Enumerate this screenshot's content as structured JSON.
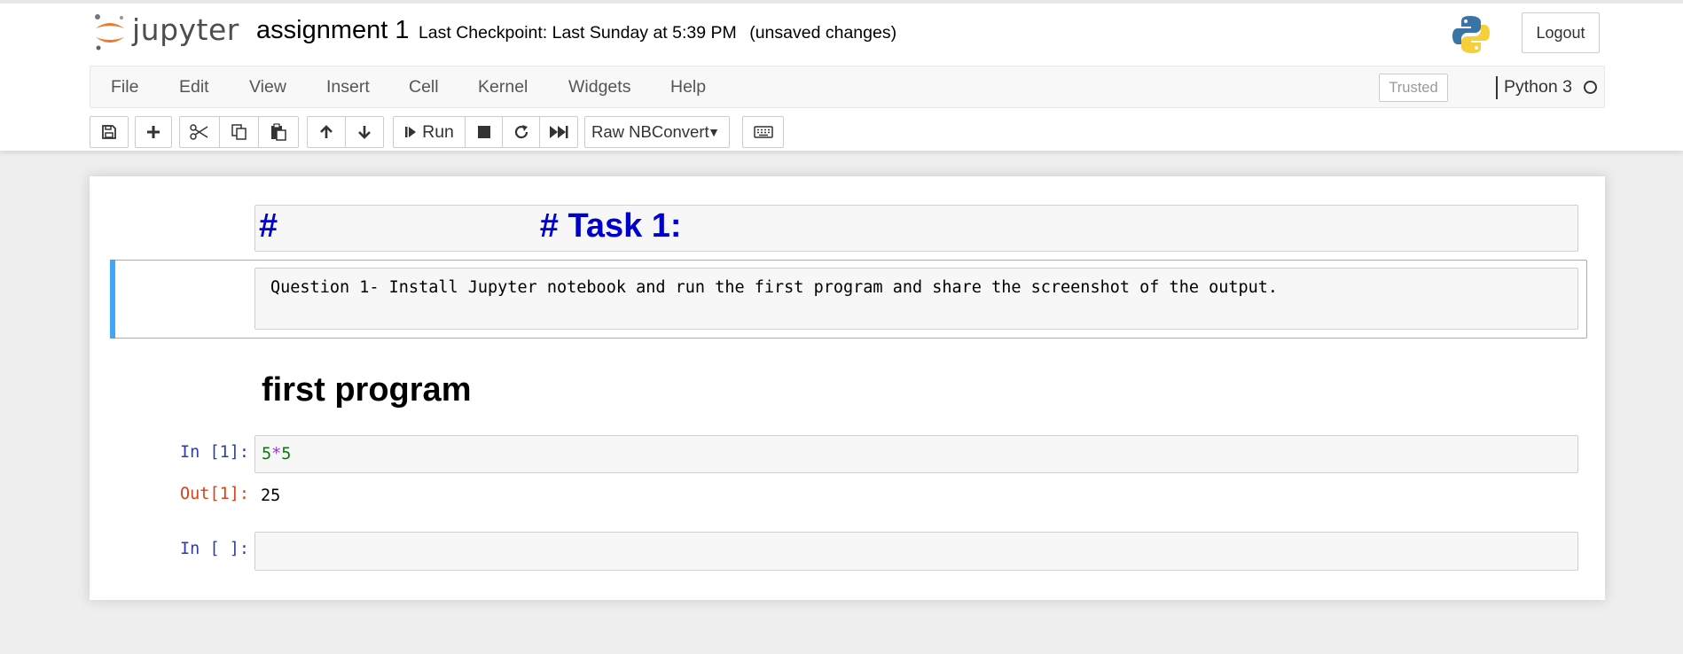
{
  "header": {
    "logo_text": "jupyter",
    "notebook_name": "assignment 1",
    "checkpoint": "Last Checkpoint: Last Sunday at 5:39 PM",
    "autosave_status": "(unsaved changes)",
    "logout_label": "Logout"
  },
  "menubar": {
    "items": [
      "File",
      "Edit",
      "View",
      "Insert",
      "Cell",
      "Kernel",
      "Widgets",
      "Help"
    ],
    "trusted_label": "Trusted",
    "kernel_name": "Python 3"
  },
  "toolbar": {
    "run_label": "Run",
    "cell_type": "Raw NBConvert",
    "icons": [
      "save-icon",
      "plus-icon",
      "scissors-icon",
      "copy-icon",
      "paste-icon",
      "arrow-up-icon",
      "arrow-down-icon",
      "step-forward-icon",
      "stop-icon",
      "refresh-icon",
      "fast-forward-icon",
      "keyboard-icon"
    ]
  },
  "cells": {
    "md1_text": "#                            # Task 1:",
    "raw_text": "Question 1- Install Jupyter notebook and run the first program and share the screenshot of the output.",
    "heading": "first program",
    "code1": {
      "prompt": "In [1]:",
      "number_a": "5",
      "operator": "*",
      "number_b": "5",
      "out_prompt": "Out[1]:",
      "output": "25"
    },
    "code2": {
      "prompt": "In [ ]:"
    }
  },
  "colors": {
    "heading_blue": "#0000cc",
    "selected_bar": "#42a5f5",
    "in_prompt": "#303f9f",
    "out_prompt": "#d84315",
    "number_green": "#008000",
    "operator_purple": "#aa22ff"
  }
}
